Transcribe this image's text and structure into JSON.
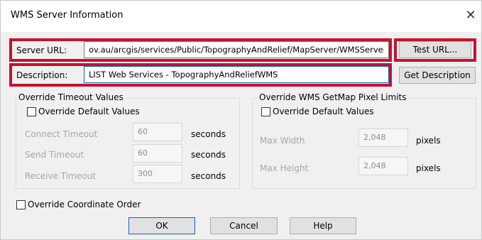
{
  "dialog": {
    "title": "WMS Server Information",
    "close_symbol": "✕"
  },
  "server": {
    "label": "Server URL:",
    "value": "ov.au/arcgis/services/Public/TopographyAndRelief/MapServer/WMSServer",
    "test_button": "Test URL..."
  },
  "description": {
    "label": "Description:",
    "value": "LIST Web Services - TopographyAndReliefWMS",
    "get_button": "Get Description"
  },
  "timeouts": {
    "group_title": "Override Timeout Values",
    "override_label": "Override Default Values",
    "override_checked": false,
    "rows": [
      {
        "label": "Connect Timeout",
        "value": "60",
        "unit": "seconds"
      },
      {
        "label": "Send Timeout",
        "value": "60",
        "unit": "seconds"
      },
      {
        "label": "Receive Timeout",
        "value": "300",
        "unit": "seconds"
      }
    ]
  },
  "pixel_limits": {
    "group_title": "Override WMS GetMap Pixel Limits",
    "override_label": "Override Default Values",
    "override_checked": false,
    "rows": [
      {
        "label": "Max Width",
        "value": "2,048",
        "unit": "pixels"
      },
      {
        "label": "Max Height",
        "value": "2,048",
        "unit": "pixels"
      }
    ]
  },
  "coordinate_order": {
    "label": "Override Coordinate Order",
    "checked": false
  },
  "buttons": {
    "ok": "OK",
    "cancel": "Cancel",
    "help": "Help"
  },
  "colors": {
    "highlight": "#c8102e",
    "focus_border": "#0a64c8",
    "dialog_bg": "#f0f0f0"
  }
}
